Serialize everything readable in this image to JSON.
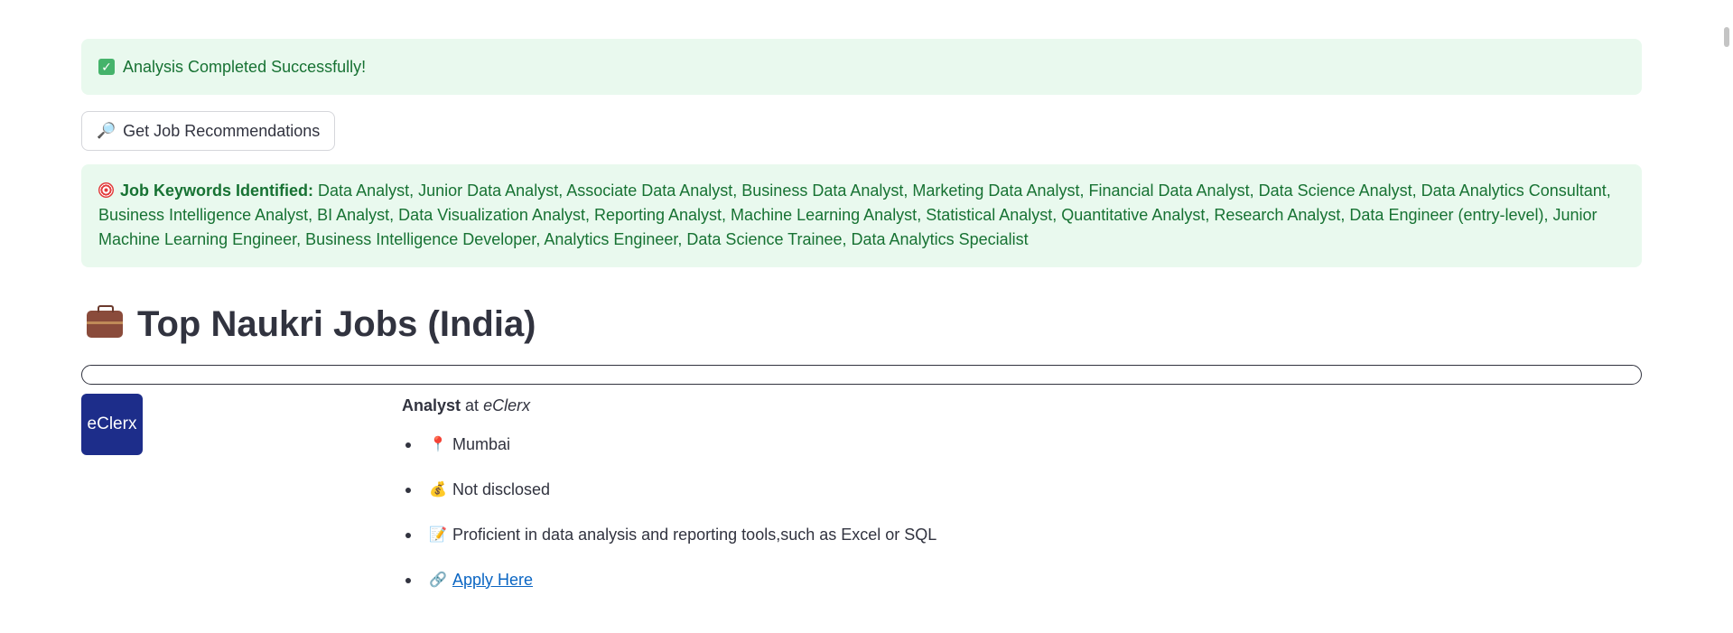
{
  "alerts": {
    "success_text": "Analysis Completed Successfully!"
  },
  "actions": {
    "recommend_label": "Get Job Recommendations"
  },
  "keywords": {
    "label": "Job Keywords Identified:",
    "text": "Data Analyst, Junior Data Analyst, Associate Data Analyst, Business Data Analyst, Marketing Data Analyst, Financial Data Analyst, Data Science Analyst, Data Analytics Consultant, Business Intelligence Analyst, BI Analyst, Data Visualization Analyst, Reporting Analyst, Machine Learning Analyst, Statistical Analyst, Quantitative Analyst, Research Analyst, Data Engineer (entry-level), Junior Machine Learning Engineer, Business Intelligence Developer, Analytics Engineer, Data Science Trainee, Data Analytics Specialist"
  },
  "section": {
    "title": "Top Naukri Jobs (India)"
  },
  "job": {
    "logo_text": "eClerx",
    "title": "Analyst",
    "at": "at",
    "company": "eClerx",
    "location": "Mumbai",
    "salary": "Not disclosed",
    "description": "Proficient in data analysis and reporting tools,such as Excel or SQL",
    "apply_label": "Apply Here"
  },
  "icons": {
    "success": "check-mark-icon",
    "button": "magnifying-glass-icon",
    "keywords": "target-icon",
    "section": "briefcase-icon",
    "location": "pin-icon",
    "salary": "money-bag-icon",
    "description": "memo-icon",
    "apply": "link-icon"
  },
  "colors": {
    "success_bg": "#e9f9ee",
    "success_text": "#177233",
    "link": "#0b66c3",
    "logo_bg": "#1d2d8a"
  }
}
